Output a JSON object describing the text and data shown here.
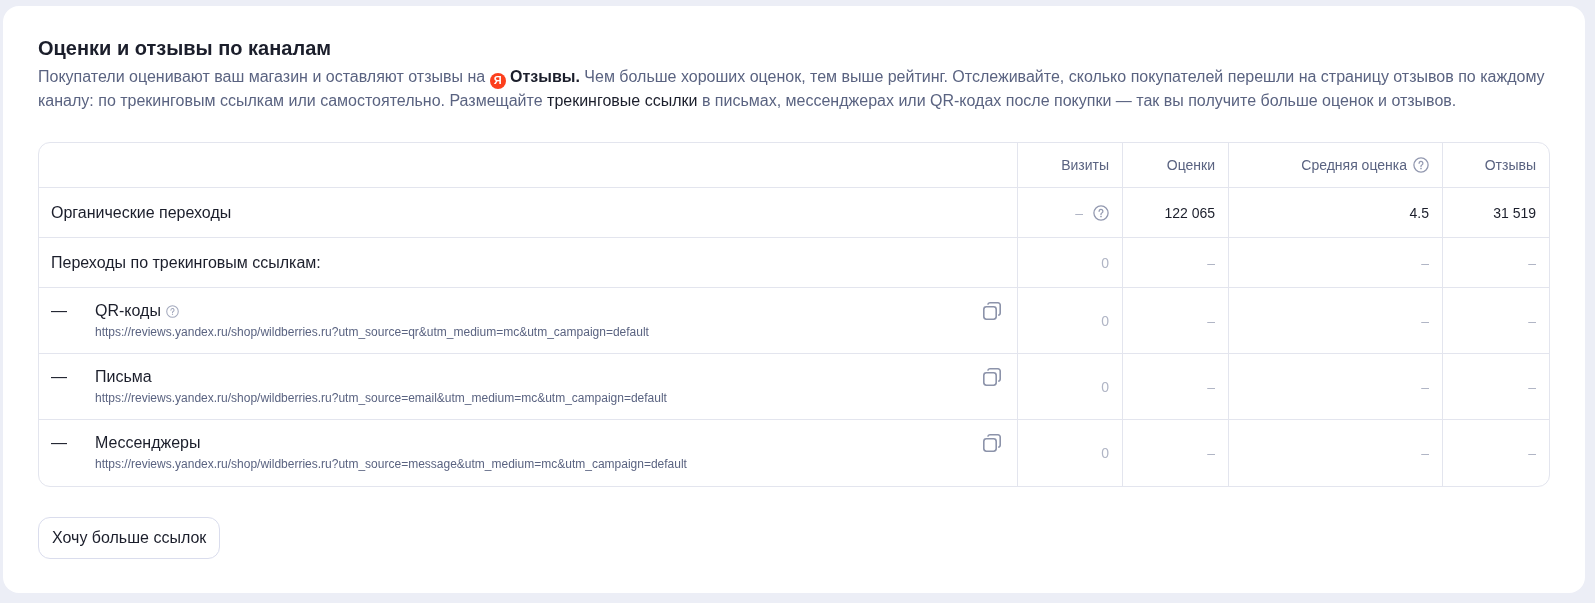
{
  "section": {
    "title": "Оценки и отзывы по каналам",
    "description": {
      "lead": "Покупатели оценивают ваш магазин и оставляют отзывы на",
      "logo_letter": "Я",
      "text": "**Отзывы.** Чем больше хороших оценок, тем выше рейтинг. Отслеживайте, сколько покупателей перешли на страницу отзывов по каждому каналу: по трекинговым ссылкам или самостоятельно. Размещайте",
      "link": "трекинговые ссылки",
      "tail": "в письмах, мессенджерах или QR-кодах после покупки — так вы получите больше оценок и отзывов."
    }
  },
  "table": {
    "columns": [
      {
        "label": "Визиты",
        "help": false
      },
      {
        "label": "Оценки",
        "help": false
      },
      {
        "label": "Средняя оценка",
        "help": true
      },
      {
        "label": "Отзывы",
        "help": false
      }
    ],
    "rows": [
      {
        "label": "Органические переходы",
        "cells": [
          {
            "text": "–",
            "muted": true,
            "help": true
          },
          {
            "text": "122 065",
            "muted": false,
            "help": false
          },
          {
            "text": "4.5",
            "muted": false,
            "help": false
          },
          {
            "text": "31 519",
            "muted": false,
            "help": false
          }
        ]
      },
      {
        "label": "Переходы по трекинговым ссылкам:",
        "cells": [
          {
            "text": "0",
            "muted": true,
            "help": false
          },
          {
            "text": "–",
            "muted": true,
            "help": false
          },
          {
            "text": "–",
            "muted": true,
            "help": false
          },
          {
            "text": "–",
            "muted": true,
            "help": false
          }
        ],
        "children": [
          {
            "marker": "—",
            "label": "QR-коды",
            "help": true,
            "url": "https://reviews.yandex.ru/shop/wildberries.ru?utm_source=qr&utm_medium=mc&utm_campaign=default",
            "cells": [
              {
                "text": "0",
                "muted": true,
                "help": false
              },
              {
                "text": "–",
                "muted": true,
                "help": false
              },
              {
                "text": "–",
                "muted": true,
                "help": false
              },
              {
                "text": "–",
                "muted": true,
                "help": false
              }
            ]
          },
          {
            "marker": "—",
            "label": "Письма",
            "help": false,
            "url": "https://reviews.yandex.ru/shop/wildberries.ru?utm_source=email&utm_medium=mc&utm_campaign=default",
            "cells": [
              {
                "text": "0",
                "muted": true,
                "help": false
              },
              {
                "text": "–",
                "muted": true,
                "help": false
              },
              {
                "text": "–",
                "muted": true,
                "help": false
              },
              {
                "text": "–",
                "muted": true,
                "help": false
              }
            ]
          },
          {
            "marker": "—",
            "label": "Мессенджеры",
            "help": false,
            "url": "https://reviews.yandex.ru/shop/wildberries.ru?utm_source=message&utm_medium=mc&utm_campaign=default",
            "cells": [
              {
                "text": "0",
                "muted": true,
                "help": false
              },
              {
                "text": "–",
                "muted": true,
                "help": false
              },
              {
                "text": "–",
                "muted": true,
                "help": false
              },
              {
                "text": "–",
                "muted": true,
                "help": false
              }
            ]
          }
        ]
      }
    ]
  },
  "button": {
    "label": "Хочу больше ссылок"
  }
}
